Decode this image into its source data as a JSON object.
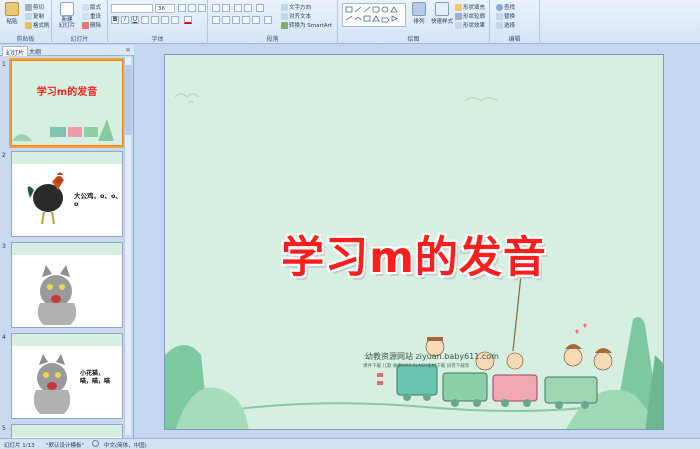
{
  "ribbon": {
    "clipboard": {
      "paste": "粘贴",
      "cut": "剪切",
      "copy": "复制",
      "format_painter": "格式刷",
      "label": "剪贴板"
    },
    "slides": {
      "new_slide": "新建\n幻灯片",
      "layout": "版式",
      "reset": "重设",
      "delete": "删除",
      "label": "幻灯片"
    },
    "font": {
      "size": "36",
      "label": "字体"
    },
    "paragraph": {
      "text_direction": "文字方向",
      "align_text": "对齐文本",
      "smartart": "转换为 SmartArt",
      "label": "段落"
    },
    "drawing": {
      "arrange": "排列",
      "quick_styles": "快速样式",
      "shape_fill": "形状填充",
      "shape_outline": "形状轮廓",
      "shape_effects": "形状效果",
      "label": "绘图"
    },
    "editing": {
      "find": "查找",
      "replace": "替换",
      "select": "选择",
      "label": "编辑"
    }
  },
  "pane": {
    "tab_slides": "幻灯片",
    "tab_outline": "大纲",
    "close": "×",
    "thumbs": [
      {
        "num": "1",
        "title": "学习m的发音"
      },
      {
        "num": "2",
        "caption": "大公鸡，o、o、o"
      },
      {
        "num": "3"
      },
      {
        "num": "4",
        "caption": "小花猫，喵，喵，喵"
      },
      {
        "num": "5"
      }
    ]
  },
  "slide": {
    "title": "学习m的发音",
    "watermark": "幼教资源网站  ziyuan.baby611.com",
    "watermark_small": "课件下载  儿歌  故事MP3  FLASH素材下载  试卷下载等"
  },
  "status": {
    "slide_pos": "幻灯片 1/13",
    "theme": "\"默认设计模板\"",
    "lang": "中文(简体，中国)"
  },
  "colors": {
    "title_red": "#ff1d1d",
    "slide_bg": "#d6efe0",
    "selection": "#f5a23a"
  }
}
